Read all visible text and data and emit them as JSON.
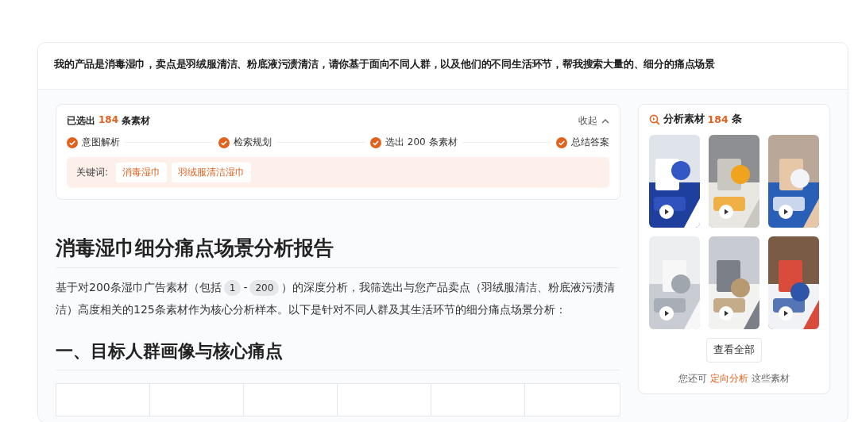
{
  "question": "我的产品是消毒湿巾，卖点是羽绒服清洁、粉底液污渍清洁，请你基于面向不同人群，以及他们的不同生活环节，帮我搜索大量的、细分的痛点场景",
  "progress": {
    "prefix": "已选出",
    "count": "184",
    "suffix": "条素材",
    "toggle": "收起",
    "expanded": true,
    "steps": [
      {
        "label": "意图解析",
        "checked": true
      },
      {
        "label": "检索规划",
        "checked": true
      },
      {
        "label": "选出 200 条素材",
        "checked": true
      },
      {
        "label": "总结答案",
        "checked": true
      }
    ],
    "keywords_label": "关键词:",
    "keywords": [
      "消毒湿巾",
      "羽绒服清洁湿巾"
    ]
  },
  "report": {
    "title": "消毒湿巾细分痛点场景分析报告",
    "intro": [
      {
        "kind": "text",
        "text": "基于对200条湿巾广告素材（包括"
      },
      {
        "kind": "ref",
        "text": "1"
      },
      {
        "kind": "text",
        "text": "-"
      },
      {
        "kind": "ref",
        "text": "200"
      },
      {
        "kind": "text",
        "text": "）的深度分析，我筛选出与您产品卖点（羽绒服清洁、粉底液污渍清洁）高度相关的125条素材作为核心分析样本。以下是针对不同人群及其生活环节的细分痛点场景分析："
      }
    ],
    "section": "一、目标人群画像与核心痛点"
  },
  "materials": {
    "title": "分析素材",
    "count": "184",
    "unit": "条",
    "items": [
      {
        "kind": "video"
      },
      {
        "kind": "video"
      },
      {
        "kind": "video"
      },
      {
        "kind": "video"
      },
      {
        "kind": "video"
      },
      {
        "kind": "video"
      }
    ],
    "view_all": "查看全部",
    "hint_prefix": "您还可",
    "hint_link": "定向分析",
    "hint_suffix": "这些素材"
  }
}
